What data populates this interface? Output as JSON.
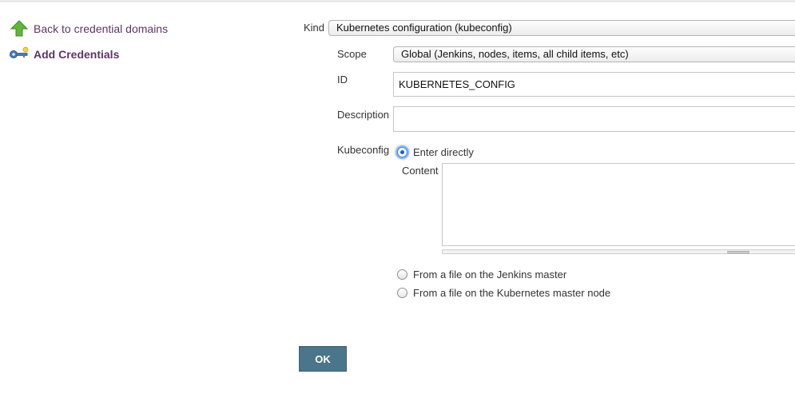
{
  "sidebar": {
    "items": [
      {
        "label": "Back to credential domains",
        "icon": "up-arrow-icon"
      },
      {
        "label": "Add Credentials",
        "icon": "key-icon"
      }
    ]
  },
  "form": {
    "kind": {
      "label": "Kind",
      "value": "Kubernetes configuration (kubeconfig)"
    },
    "scope": {
      "label": "Scope",
      "value": "Global (Jenkins, nodes, items, all child items, etc)"
    },
    "id": {
      "label": "ID",
      "value": "KUBERNETES_CONFIG"
    },
    "description": {
      "label": "Description",
      "value": ""
    },
    "kubeconfig": {
      "label": "Kubeconfig",
      "options": [
        {
          "label": "Enter directly",
          "checked": true
        },
        {
          "label": "From a file on the Jenkins master",
          "checked": false
        },
        {
          "label": "From a file on the Kubernetes master node",
          "checked": false
        }
      ],
      "content_label": "Content",
      "content_value": ""
    },
    "ok_label": "OK"
  },
  "colors": {
    "link": "#5c3566",
    "button": "#4b758b",
    "radio_focus": "#3b87e0"
  }
}
